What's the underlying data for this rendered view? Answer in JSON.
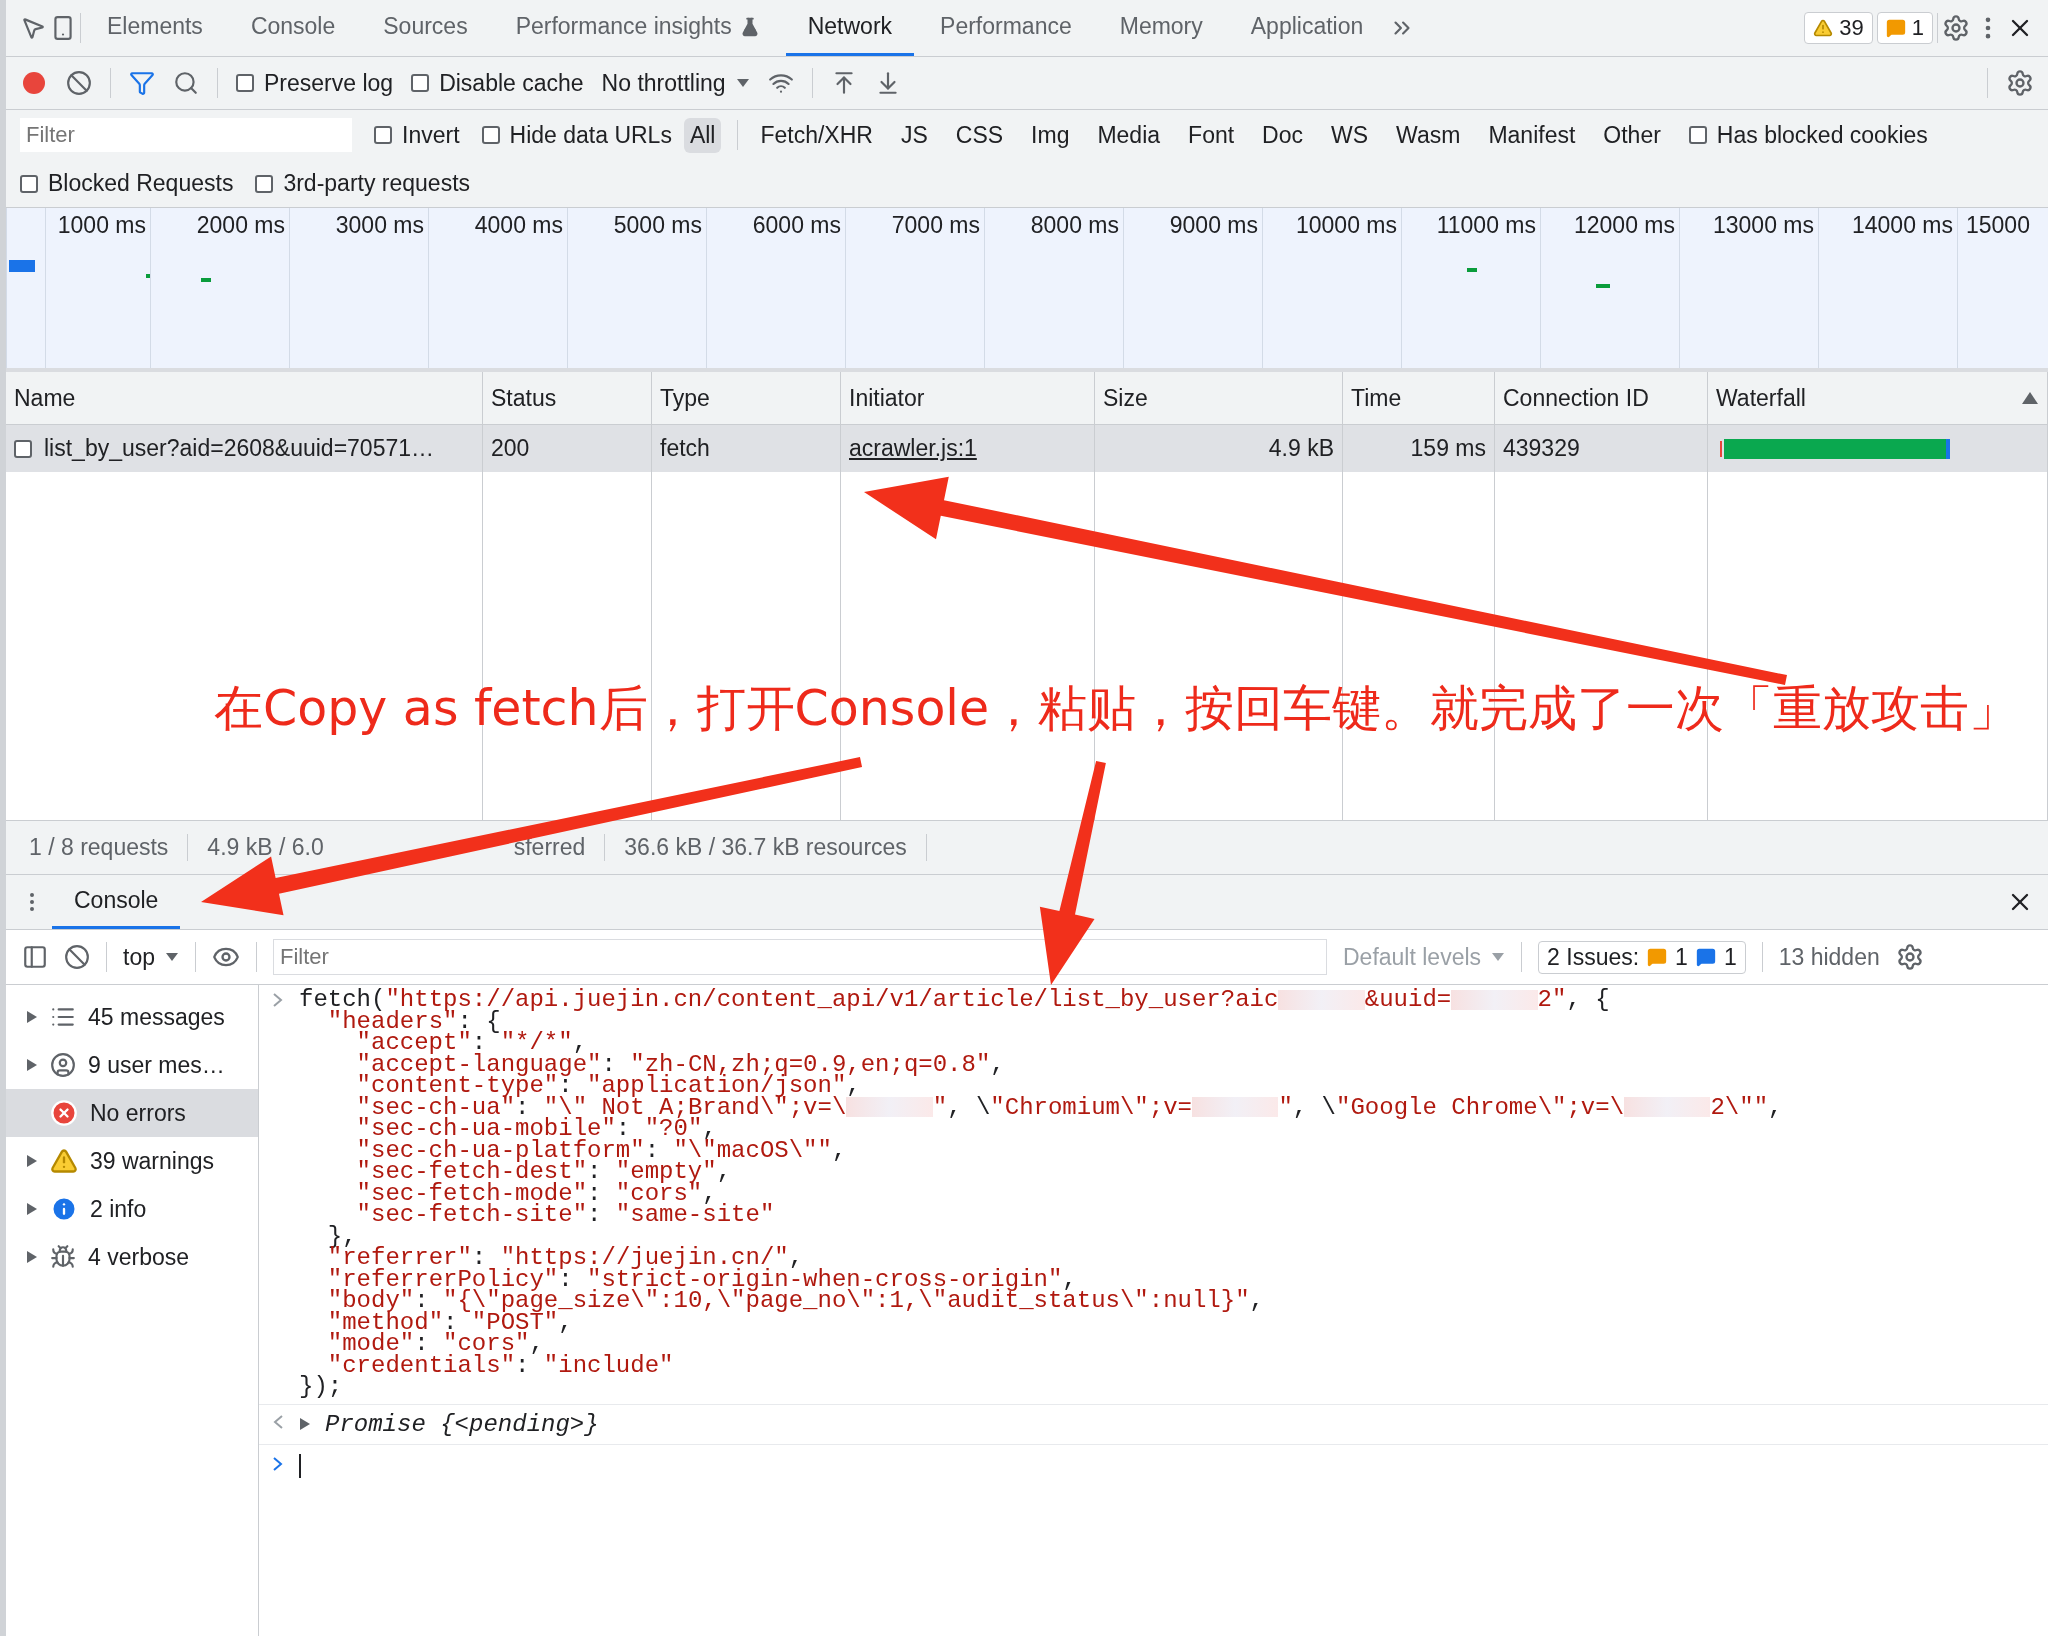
{
  "top_tabs": [
    {
      "label": "Elements",
      "selected": false,
      "kind": "plain"
    },
    {
      "label": "Console",
      "selected": false,
      "kind": "plain"
    },
    {
      "label": "Sources",
      "selected": false,
      "kind": "plain"
    },
    {
      "label": "Performance insights",
      "selected": false,
      "kind": "experimental"
    },
    {
      "label": "Network",
      "selected": true,
      "kind": "plain"
    },
    {
      "label": "Performance",
      "selected": false,
      "kind": "plain"
    },
    {
      "label": "Memory",
      "selected": false,
      "kind": "plain"
    },
    {
      "label": "Application",
      "selected": false,
      "kind": "plain"
    }
  ],
  "badges": {
    "warnings": "39",
    "issues": "1"
  },
  "toolbar": {
    "recording": true,
    "options": [
      {
        "label": "Preserve log",
        "checked": false
      },
      {
        "label": "Disable cache",
        "checked": false
      }
    ],
    "throttling": "No throttling"
  },
  "filter_bar": {
    "placeholder": "Filter",
    "options": [
      {
        "label": "Invert",
        "checked": false
      },
      {
        "label": "Hide data URLs",
        "checked": false
      }
    ],
    "types": [
      {
        "label": "All",
        "selected": true
      },
      {
        "label": "Fetch/XHR",
        "selected": false
      },
      {
        "label": "JS",
        "selected": false
      },
      {
        "label": "CSS",
        "selected": false
      },
      {
        "label": "Img",
        "selected": false
      },
      {
        "label": "Media",
        "selected": false
      },
      {
        "label": "Font",
        "selected": false
      },
      {
        "label": "Doc",
        "selected": false
      },
      {
        "label": "WS",
        "selected": false
      },
      {
        "label": "Wasm",
        "selected": false
      },
      {
        "label": "Manifest",
        "selected": false
      },
      {
        "label": "Other",
        "selected": false
      }
    ],
    "extra_options": [
      {
        "label": "Has blocked cookies",
        "checked": false
      }
    ],
    "second_row": [
      {
        "label": "Blocked Requests",
        "checked": false
      },
      {
        "label": "3rd-party requests",
        "checked": false
      }
    ]
  },
  "timeline": {
    "ticks": [
      "1000 ms",
      "2000 ms",
      "3000 ms",
      "4000 ms",
      "5000 ms",
      "6000 ms",
      "7000 ms",
      "8000 ms",
      "9000 ms",
      "10000 ms",
      "11000 ms",
      "12000 ms",
      "13000 ms",
      "14000 ms",
      "15000"
    ]
  },
  "table": {
    "columns": [
      "Name",
      "Status",
      "Type",
      "Initiator",
      "Size",
      "Time",
      "Connection ID",
      "Waterfall"
    ],
    "rows": [
      {
        "selected": true,
        "cells": [
          "list_by_user?aid=2608&uuid=70571…",
          "200",
          "fetch",
          "acrawler.js:1",
          "4.9 kB",
          "159 ms",
          "439329"
        ]
      }
    ]
  },
  "status_bar": [
    [
      "1 / 8 requests"
    ],
    [
      "4.9 kB / 6.0",
      "sferred"
    ],
    [
      "36.6 kB / 36.7 kB resources"
    ]
  ],
  "drawer": {
    "tab": "Console"
  },
  "console": {
    "context": "top",
    "filter_placeholder": "Filter",
    "levels": "Default levels",
    "issues_label": "2 Issues:",
    "issue_warnings": "1",
    "issue_info": "1",
    "hidden": "13 hidden",
    "sidebar": [
      {
        "label": "45 messages",
        "kind": "all",
        "selected": false
      },
      {
        "label": "9 user mes…",
        "kind": "user",
        "selected": false
      },
      {
        "label": "No errors",
        "kind": "error",
        "selected": true
      },
      {
        "label": "39 warnings",
        "kind": "warning",
        "selected": false
      },
      {
        "label": "2 info",
        "kind": "info",
        "selected": false
      },
      {
        "label": "4 verbose",
        "kind": "verbose",
        "selected": false
      }
    ],
    "entries": [
      {
        "kind": "input",
        "lines": [
          [
            "fetch(\"https://api.juejin.cn/content_api/v1/article/list_by_user?aic",
            {
              "kind": "redacted"
            },
            "&uuid=",
            {
              "kind": "redacted"
            },
            "2\", {"
          ],
          [
            "  \"headers\": {"
          ],
          [
            "    \"accept\": \"*/*\","
          ],
          [
            "    \"accept-language\": \"zh-CN,zh;q=0.9,en;q=0.8\","
          ],
          [
            "    \"content-type\": \"application/json\","
          ],
          [
            "    \"sec-ch-ua\": \"\\\" Not A;Brand\\\";v=\\",
            {
              "kind": "redacted"
            },
            "\", \\\"Chromium\\\";v=",
            {
              "kind": "redacted"
            },
            "\", \\\"Google Chrome\\\";v=\\",
            {
              "kind": "redacted"
            },
            "2\\\"\","
          ],
          [
            "    \"sec-ch-ua-mobile\": \"?0\","
          ],
          [
            "    \"sec-ch-ua-platform\": \"\\\"macOS\\\"\","
          ],
          [
            "    \"sec-fetch-dest\": \"empty\","
          ],
          [
            "    \"sec-fetch-mode\": \"cors\","
          ],
          [
            "    \"sec-fetch-site\": \"same-site\""
          ],
          [
            "  },"
          ],
          [
            "  \"referrer\": \"https://juejin.cn/\","
          ],
          [
            "  \"referrerPolicy\": \"strict-origin-when-cross-origin\","
          ],
          [
            "  \"body\": \"{\\\"page_size\\\":10,\\\"page_no\\\":1,\\\"audit_status\\\":null}\","
          ],
          [
            "  \"method\": \"POST\","
          ],
          [
            "  \"mode\": \"cors\","
          ],
          [
            "  \"credentials\": \"include\""
          ],
          [
            "});"
          ]
        ]
      },
      {
        "kind": "result",
        "text": "Promise {<pending>}"
      },
      {
        "kind": "prompt"
      }
    ]
  },
  "annotation": {
    "text": "在Copy as fetch后，打开Console，粘贴，按回车键。就完成了一次「重放攻击」"
  }
}
